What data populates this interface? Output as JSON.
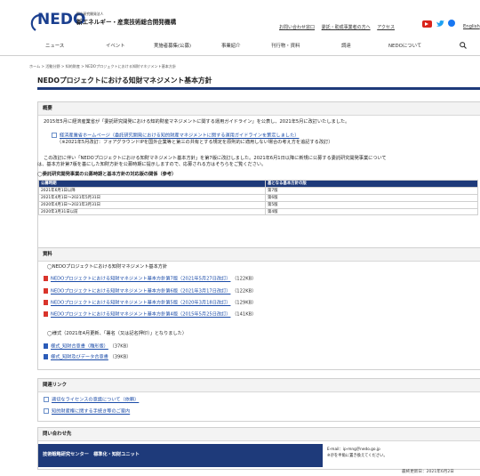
{
  "header": {
    "logo_text": "NEDO",
    "org_small": "国立研究開発法人",
    "org_name": "新エネルギー・産業技術総合開発機構",
    "util_links": [
      "お問い合わせ窓口",
      "委託・助成事業者の方へ",
      "アクセス"
    ],
    "lang_label": "English",
    "social_icons": [
      "youtube-icon",
      "twitter-icon",
      "facebook-icon"
    ]
  },
  "nav": {
    "items": [
      "ニュース",
      "イベント",
      "実施者募集(公募)",
      "事業紹介",
      "刊行物・資料",
      "調達",
      "NEDOについて"
    ]
  },
  "breadcrumb": "ホーム > 活動分野 > 知的財産 > NEDOプロジェクトにおける知財マネジメント基本方針",
  "page_title": "NEDOプロジェクトにおける知財マネジメント基本方針",
  "overview": {
    "heading": "概要",
    "para1": "2015年5月に経済産業省が「委託研究開発における知的財産マネジメントに関する運用ガイドライン」を公表し、2021年5月に改訂いたしました。",
    "link_text": "経済産業省ホームページ（委託研究開発における知的財産マネジメントに関する運用ガイドラインを策定しました）",
    "link_note": "（※2021年5月改訂：フォアグラウンドIPを国外企業等と第三の共有とする規定を原則的に適用しない場合の考え方を追記する改訂）",
    "para2a": "この改訂に伴い「NEDOプロジェクトにおける知財マネジメント基本方針」を第7版に改訂しました。2021年6月1日以降に新規に公募する委託研究開発事業について",
    "para2b": "は、基本方針第7版を基にした知財方針を公募時期に提示しますので、応募される方はそちらをご覧ください。",
    "table_caption": "◯委託研究開発事業の公募時期と基本方針の対応版の関係（参考）",
    "table_headers": [
      "公募時期",
      "基となる基本方針の版"
    ],
    "table_rows": [
      [
        "2021年6月1日以降",
        "第7版"
      ],
      [
        "2021年4月1日〜2021年5月31日",
        "第6版"
      ],
      [
        "2020年4月1日〜2021年3月31日",
        "第5版"
      ],
      [
        "2020年3月31日以前",
        "第4版"
      ]
    ]
  },
  "materials": {
    "heading": "資料",
    "sub1": "◯NEDOプロジェクトにおける知財マネジメント基本方針",
    "docs": [
      {
        "text": "NEDOプロジェクトにおける知財マネジメント基本方針第7版（2021年5月27日改訂）",
        "size": "（122KB）"
      },
      {
        "text": "NEDOプロジェクトにおける知財マネジメント基本方針第6版（2021年3月17日改訂）",
        "size": "（122KB）"
      },
      {
        "text": "NEDOプロジェクトにおける知財マネジメント基本方針第5版（2020年3月18日改訂）",
        "size": "（129KB）"
      },
      {
        "text": "NEDOプロジェクトにおける知財マネジメント基本方針第4版（2015年5月25日改訂）",
        "size": "（141KB）"
      }
    ],
    "sub2": "◯様式（2021年4月更新、「署名（又は記名押印）」となりました）",
    "forms": [
      {
        "text": "様式_知財合意書（雛形版）",
        "size": "（37KB）"
      },
      {
        "text": "様式_知財及びデータ合意書",
        "size": "（39KB）"
      }
    ]
  },
  "related": {
    "heading": "関連リンク",
    "links": [
      "適切なライセンスの意識について（依頼）",
      "知的財産権に関する手続き等のご案内"
    ]
  },
  "contact": {
    "heading": "問い合わせ先",
    "dept": "技術戦略研究センター　標準化・知財ユニット",
    "email": "E-mail：ip-mng＠nedo.go.jp",
    "email_note": "※＠を半角に置き換えてください。"
  },
  "footer": {
    "last_updated": "最終更新日：2021年6月2日"
  }
}
